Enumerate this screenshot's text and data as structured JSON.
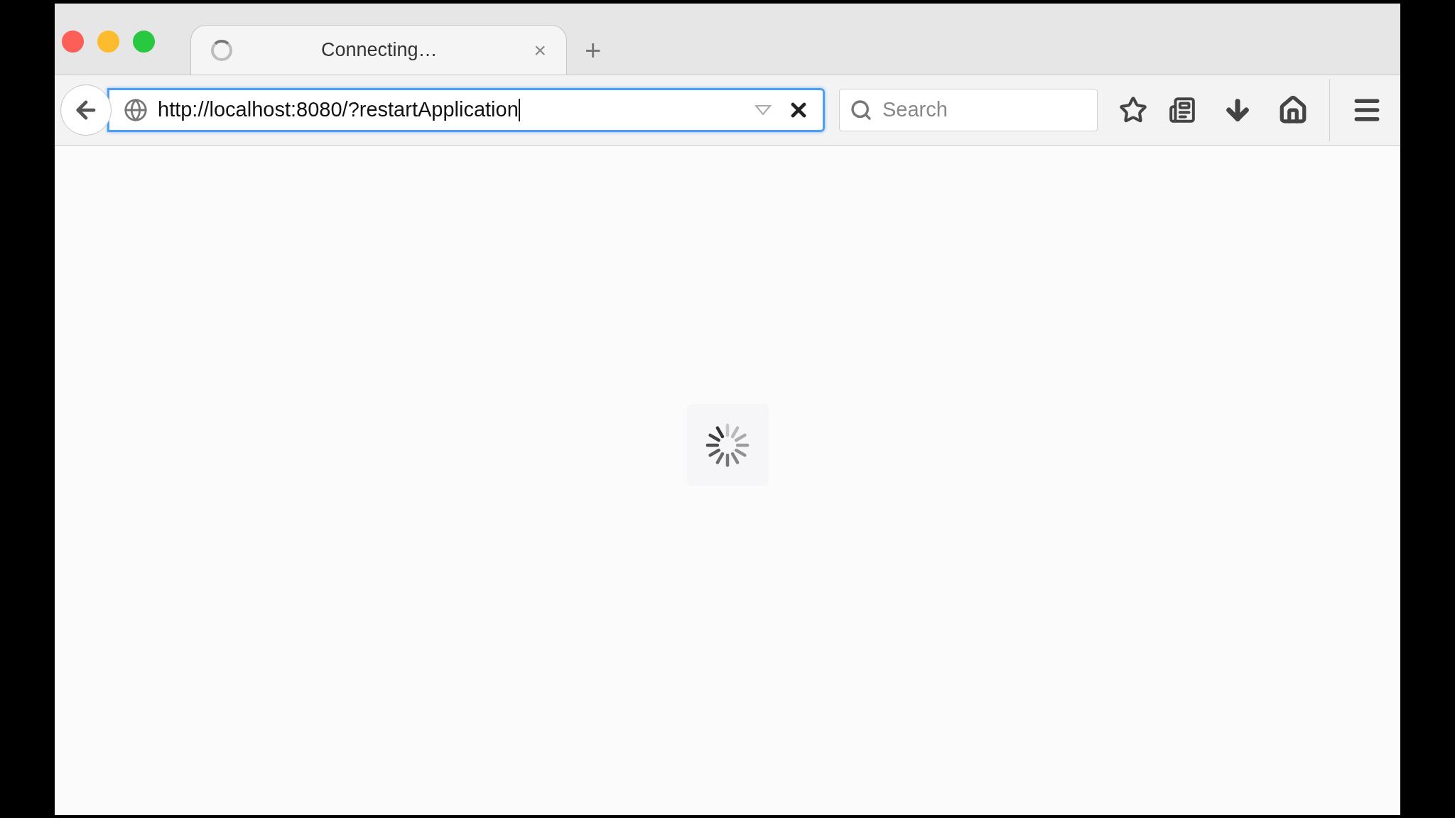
{
  "tab": {
    "title": "Connecting…",
    "loading": true,
    "close": "×"
  },
  "new_tab": "+",
  "address_bar": {
    "value": "http://localhost:8080/?restartApplication",
    "focused": true
  },
  "search": {
    "placeholder": "Search"
  },
  "page": {
    "loading": true
  }
}
